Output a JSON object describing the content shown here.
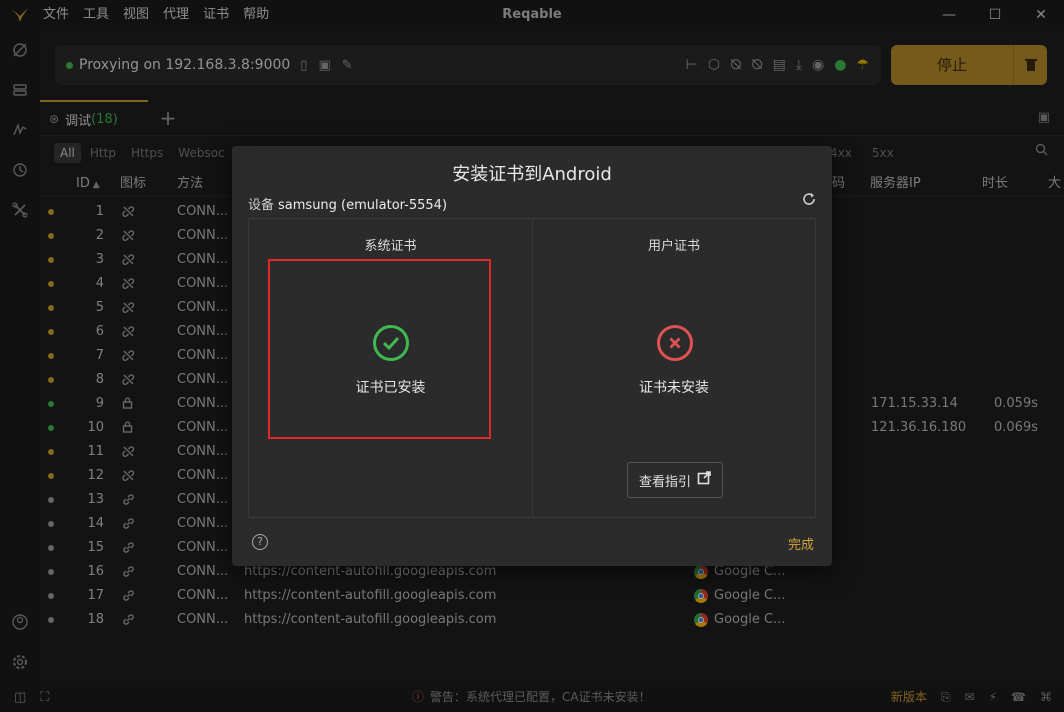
{
  "app": {
    "title": "Reqable",
    "menu": [
      "文件",
      "工具",
      "视图",
      "代理",
      "证书",
      "帮助"
    ],
    "window_controls": [
      "minimize",
      "maximize",
      "close"
    ]
  },
  "proxy": {
    "status_text": "Proxying on 192.168.3.8:9000",
    "stop_label": "停止"
  },
  "tab": {
    "name": "调试",
    "count": "(18)"
  },
  "filters": [
    "All",
    "Http",
    "Https",
    "Websoc"
  ],
  "filters_tail": [
    "4xx",
    "5xx"
  ],
  "table": {
    "headers": {
      "id": "ID",
      "icon": "图标",
      "method": "方法",
      "partial": "码",
      "server_ip": "服务器IP",
      "duration": "时长",
      "size": "大"
    },
    "rows": [
      {
        "dot": "#c9a227",
        "id": "1",
        "icon": "unlink",
        "method": "CONN...",
        "url": "",
        "app": "",
        "ip": "",
        "time": ""
      },
      {
        "dot": "#c9a227",
        "id": "2",
        "icon": "unlink",
        "method": "CONN...",
        "url": "",
        "app": "",
        "ip": "",
        "time": ""
      },
      {
        "dot": "#c9a227",
        "id": "3",
        "icon": "unlink",
        "method": "CONN...",
        "url": "",
        "app": "",
        "ip": "",
        "time": ""
      },
      {
        "dot": "#c9a227",
        "id": "4",
        "icon": "unlink",
        "method": "CONN...",
        "url": "",
        "app": "",
        "ip": "",
        "time": ""
      },
      {
        "dot": "#c9a227",
        "id": "5",
        "icon": "unlink",
        "method": "CONN...",
        "url": "",
        "app": "",
        "ip": "",
        "time": ""
      },
      {
        "dot": "#c9a227",
        "id": "6",
        "icon": "unlink",
        "method": "CONN...",
        "url": "",
        "app": "",
        "ip": "",
        "time": ""
      },
      {
        "dot": "#c9a227",
        "id": "7",
        "icon": "unlink",
        "method": "CONN...",
        "url": "",
        "app": "",
        "ip": "",
        "time": ""
      },
      {
        "dot": "#c9a227",
        "id": "8",
        "icon": "unlink",
        "method": "CONN...",
        "url": "",
        "app": "",
        "ip": "",
        "time": ""
      },
      {
        "dot": "#3fb950",
        "id": "9",
        "icon": "lock",
        "method": "CONN...",
        "url": "",
        "app": "",
        "ip": "171.15.33.14",
        "time": "0.059s"
      },
      {
        "dot": "#3fb950",
        "id": "10",
        "icon": "lock",
        "method": "CONN...",
        "url": "",
        "app": "",
        "ip": "121.36.16.180",
        "time": "0.069s"
      },
      {
        "dot": "#c9a227",
        "id": "11",
        "icon": "unlink",
        "method": "CONN...",
        "url": "",
        "app": "",
        "ip": "",
        "time": ""
      },
      {
        "dot": "#c9a227",
        "id": "12",
        "icon": "unlink",
        "method": "CONN...",
        "url": "",
        "app": "",
        "ip": "",
        "time": ""
      },
      {
        "dot": "#9a9a9a",
        "id": "13",
        "icon": "link",
        "method": "CONN...",
        "url": "",
        "app": "",
        "ip": "",
        "time": ""
      },
      {
        "dot": "#9a9a9a",
        "id": "14",
        "icon": "link",
        "method": "CONN...",
        "url": "",
        "app": "",
        "ip": "",
        "time": ""
      },
      {
        "dot": "#9a9a9a",
        "id": "15",
        "icon": "link",
        "method": "CONN...",
        "url": "",
        "app": "",
        "ip": "",
        "time": ""
      },
      {
        "dot": "#9a9a9a",
        "id": "16",
        "icon": "link",
        "method": "CONN...",
        "url": "https://content-autofill.googleapis.com",
        "app": "Google C...",
        "ip": "",
        "time": ""
      },
      {
        "dot": "#9a9a9a",
        "id": "17",
        "icon": "link",
        "method": "CONN...",
        "url": "https://content-autofill.googleapis.com",
        "app": "Google C...",
        "ip": "",
        "time": ""
      },
      {
        "dot": "#9a9a9a",
        "id": "18",
        "icon": "link",
        "method": "CONN...",
        "url": "https://content-autofill.googleapis.com",
        "app": "Google C...",
        "ip": "",
        "time": ""
      }
    ]
  },
  "status_bar": {
    "warning": "警告：系统代理已配置，CA证书未安装！",
    "new_version": "新版本"
  },
  "dialog": {
    "title": "安装证书到Android",
    "device_label": "设备",
    "device_name": "samsung (emulator-5554)",
    "system_cert": {
      "heading": "系统证书",
      "status": "证书已安装"
    },
    "user_cert": {
      "heading": "用户证书",
      "status": "证书未安装",
      "guide_label": "查看指引"
    },
    "done_label": "完成",
    "help_glyph": "?"
  },
  "colors": {
    "accent": "#c9962e",
    "ok": "#3fb950",
    "error": "#e05252",
    "highlight_frame": "#e02a2a"
  }
}
